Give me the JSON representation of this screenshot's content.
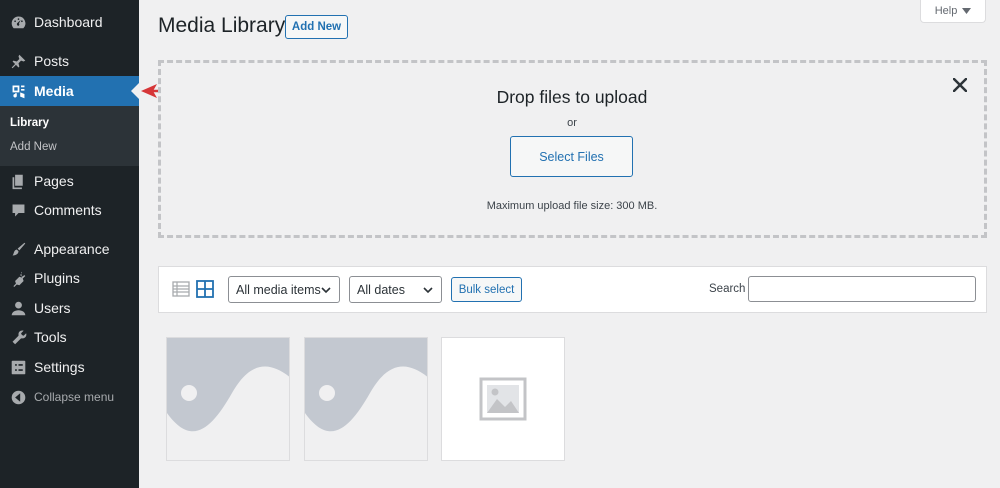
{
  "sidebar": {
    "items": [
      {
        "label": "Dashboard",
        "icon": "dashboard-icon"
      },
      {
        "label": "Posts",
        "icon": "pin-icon"
      },
      {
        "label": "Media",
        "icon": "media-icon"
      },
      {
        "label": "Pages",
        "icon": "pages-icon"
      },
      {
        "label": "Comments",
        "icon": "comment-icon"
      },
      {
        "label": "Appearance",
        "icon": "paintbrush-icon"
      },
      {
        "label": "Plugins",
        "icon": "plugin-icon"
      },
      {
        "label": "Users",
        "icon": "user-icon"
      },
      {
        "label": "Tools",
        "icon": "wrench-icon"
      },
      {
        "label": "Settings",
        "icon": "settings-icon"
      }
    ],
    "submenu": [
      {
        "label": "Library"
      },
      {
        "label": "Add New"
      }
    ],
    "collapse_label": "Collapse menu",
    "active_color": "#2271b1"
  },
  "header": {
    "title": "Media Library",
    "add_new_label": "Add New",
    "help_label": "Help"
  },
  "uploader": {
    "title": "Drop files to upload",
    "or_text": "or",
    "select_files_label": "Select Files",
    "max_upload_text": "Maximum upload file size: 300 MB."
  },
  "toolbar": {
    "media_filter": "All media items",
    "date_filter": "All dates",
    "bulk_select_label": "Bulk select",
    "search_label": "Search",
    "search_value": ""
  },
  "thumbnails": [
    {
      "type": "image-placeholder-icon"
    },
    {
      "type": "image-placeholder-icon"
    },
    {
      "type": "document-image-icon"
    }
  ],
  "annotation": {
    "arrow_color": "#d63638"
  }
}
